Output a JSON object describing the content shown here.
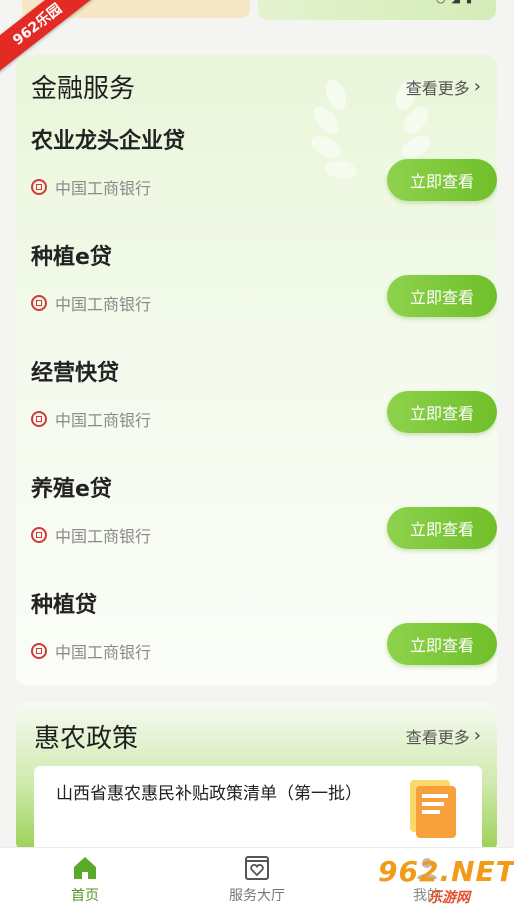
{
  "ribbon": {
    "text": "962乐园"
  },
  "finance": {
    "title": "金融服务",
    "more_label": "查看更多",
    "items": [
      {
        "name": "农业龙头企业贷",
        "bank": "中国工商银行",
        "button": "立即查看"
      },
      {
        "name": "种植e贷",
        "bank": "中国工商银行",
        "button": "立即查看"
      },
      {
        "name": "经营快贷",
        "bank": "中国工商银行",
        "button": "立即查看"
      },
      {
        "name": "养殖e贷",
        "bank": "中国工商银行",
        "button": "立即查看"
      },
      {
        "name": "种植贷",
        "bank": "中国工商银行",
        "button": "立即查看"
      }
    ]
  },
  "policy": {
    "title": "惠农政策",
    "more_label": "查看更多",
    "item_text": "山西省惠农惠民补贴政策清单（第一批）"
  },
  "nav": {
    "home": "首页",
    "hall": "服务大厅",
    "mine": "我的"
  },
  "watermark": {
    "top": "962.NET",
    "bottom": "乐游网"
  },
  "colors": {
    "accent": "#6fbf2a",
    "nav_active": "#4f9a22",
    "bank_red": "#d03a3a"
  },
  "icons": [
    "location-icon",
    "wifi-icon",
    "signal-icon",
    "battery-icon",
    "chevron-right-icon",
    "bank-logo-icon",
    "home-icon",
    "service-hall-icon",
    "user-icon"
  ]
}
